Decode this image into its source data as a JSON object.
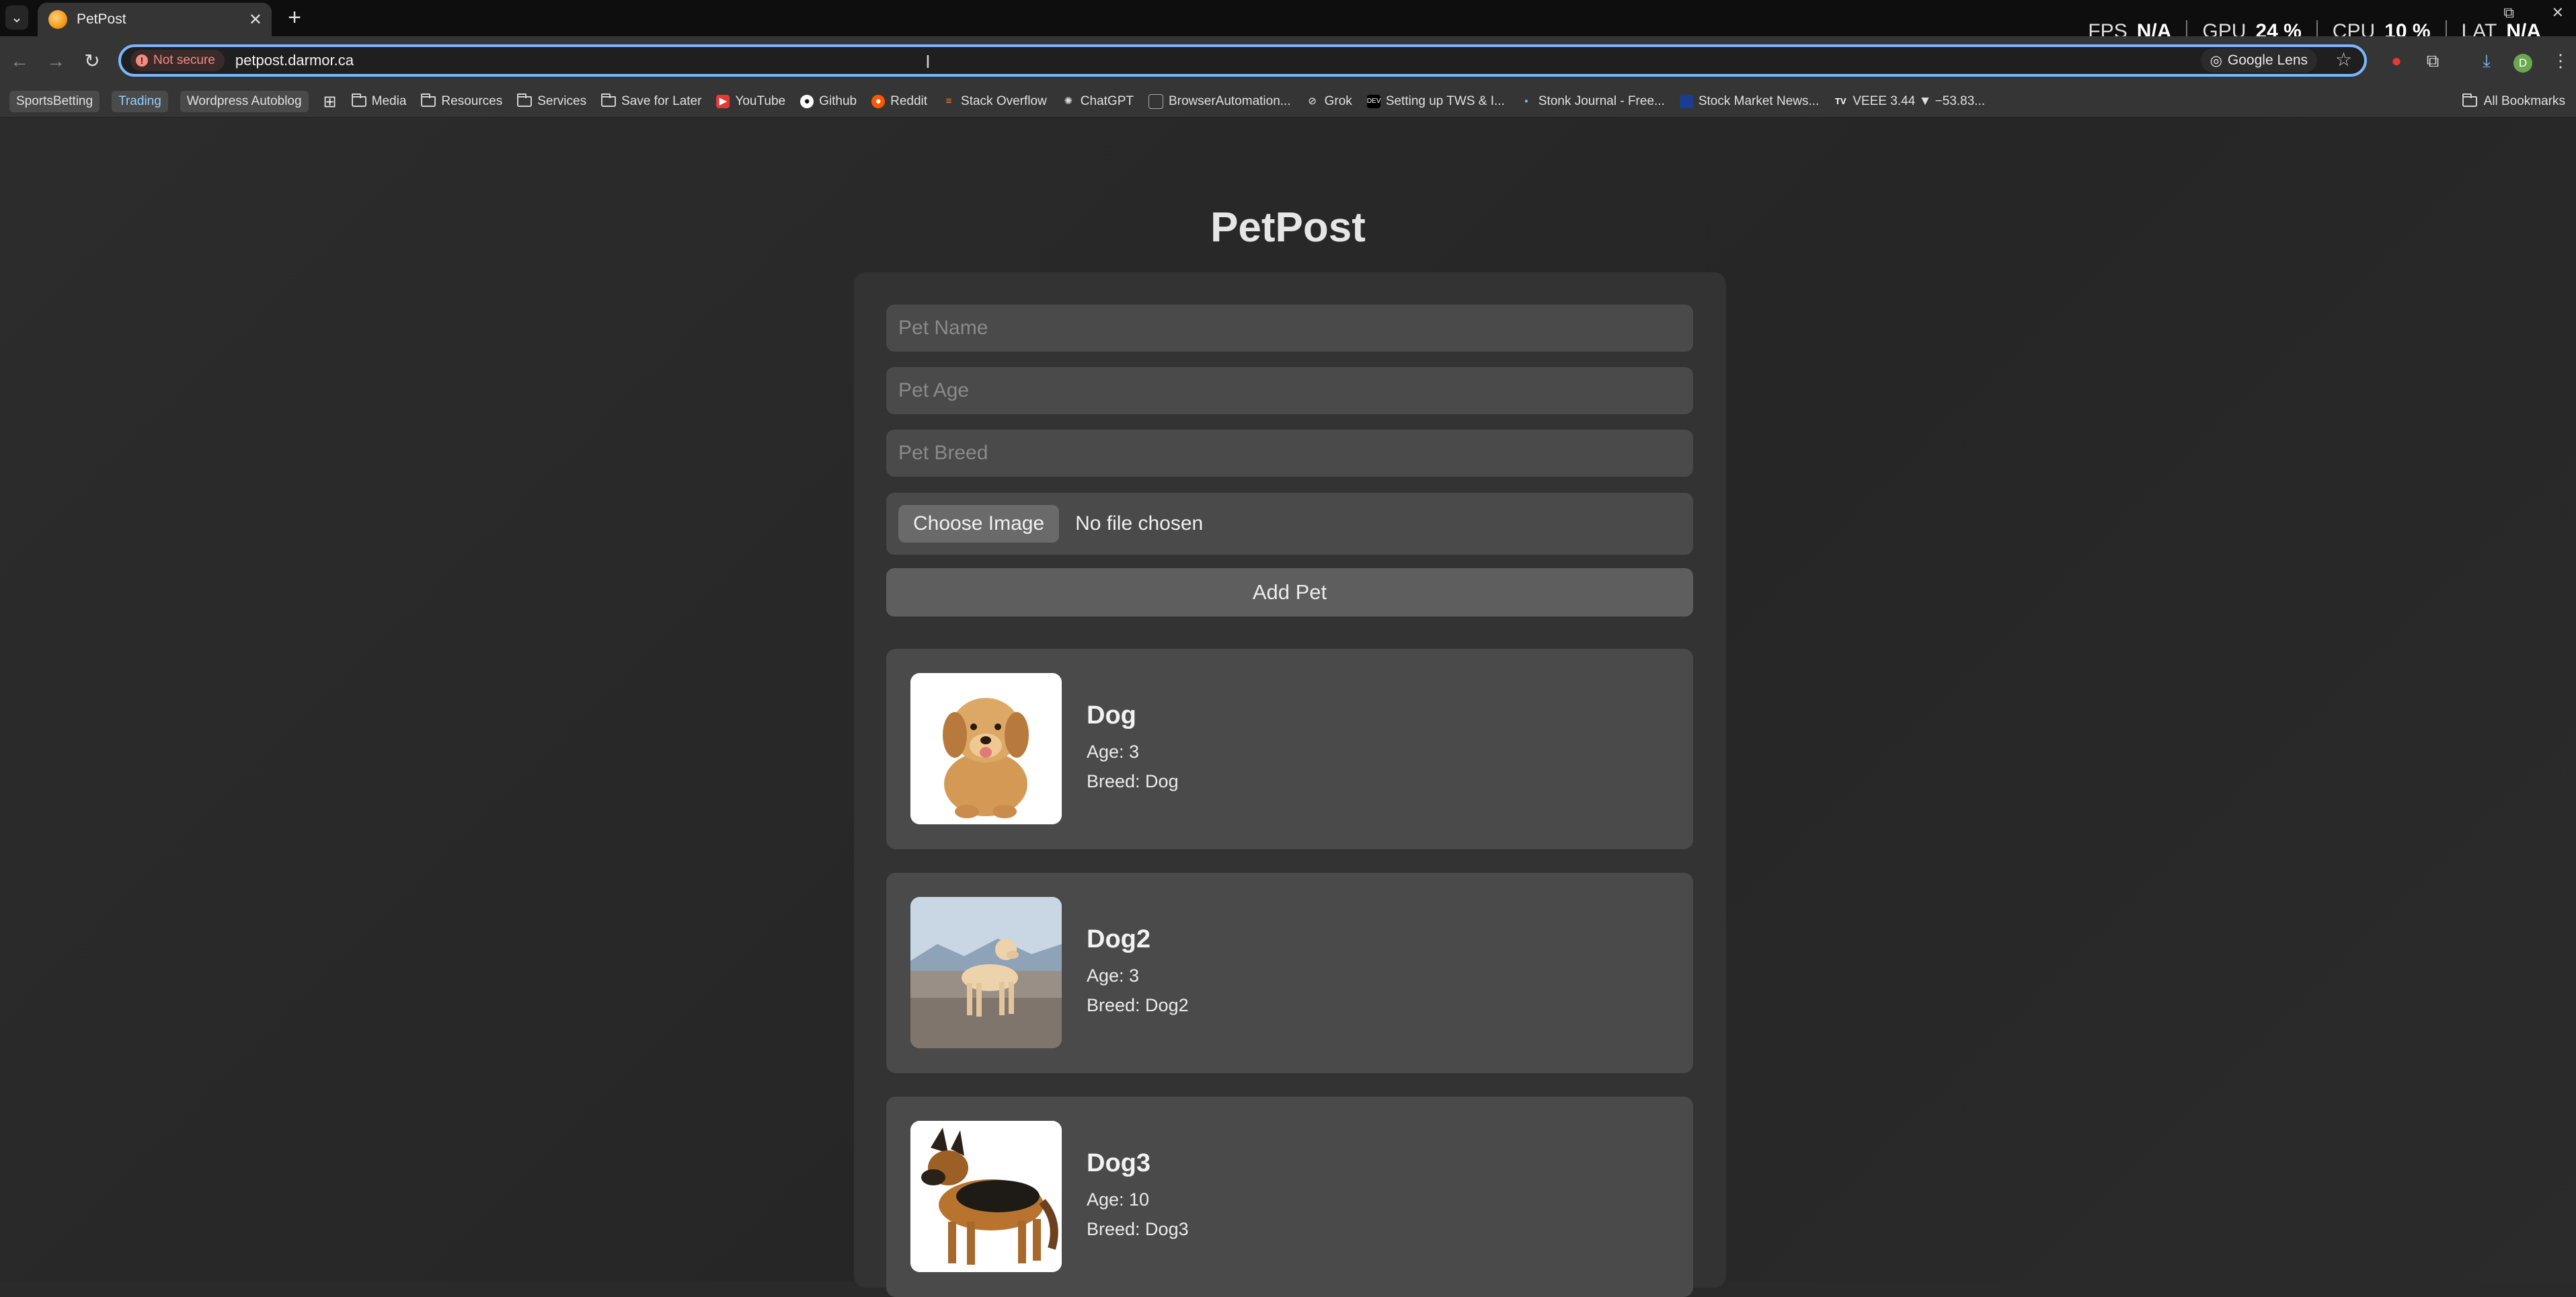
{
  "browser": {
    "tab_title": "PetPost",
    "security_chip": "Not secure",
    "url": "petpost.darmor.ca",
    "lens_label": "Google Lens",
    "perf": {
      "fps_label": "FPS",
      "fps_value": "N/A",
      "gpu_label": "GPU",
      "gpu_value": "24 %",
      "cpu_label": "CPU",
      "cpu_value": "10 %",
      "lat_label": "LAT",
      "lat_value": "N/A"
    },
    "profile_initial": "D",
    "bookmarks": [
      {
        "label": "SportsBetting",
        "kind": "pill"
      },
      {
        "label": "Trading",
        "kind": "pill"
      },
      {
        "label": "Wordpress Autoblog",
        "kind": "pill"
      },
      {
        "label": "Media",
        "kind": "folder"
      },
      {
        "label": "Resources",
        "kind": "folder"
      },
      {
        "label": "Services",
        "kind": "folder"
      },
      {
        "label": "Save for Later",
        "kind": "folder"
      },
      {
        "label": "YouTube",
        "kind": "site",
        "icon": "youtube-icon"
      },
      {
        "label": "Github",
        "kind": "site",
        "icon": "github-icon"
      },
      {
        "label": "Reddit",
        "kind": "site",
        "icon": "reddit-icon"
      },
      {
        "label": "Stack Overflow",
        "kind": "site",
        "icon": "stackoverflow-icon"
      },
      {
        "label": "ChatGPT",
        "kind": "site",
        "icon": "chatgpt-icon"
      },
      {
        "label": "BrowserAutomation...",
        "kind": "site",
        "icon": "page-icon"
      },
      {
        "label": "Grok",
        "kind": "site",
        "icon": "grok-icon"
      },
      {
        "label": "Setting up TWS & I...",
        "kind": "site",
        "icon": "dev-icon"
      },
      {
        "label": "Stonk Journal - Free...",
        "kind": "site",
        "icon": "page-icon"
      },
      {
        "label": "Stock Market News...",
        "kind": "site",
        "icon": "page-icon"
      },
      {
        "label": "VEEE 3.44 ▼ −53.83...",
        "kind": "site",
        "icon": "tv-icon"
      }
    ],
    "all_bookmarks": "All Bookmarks"
  },
  "app": {
    "title": "PetPost",
    "form": {
      "name_placeholder": "Pet Name",
      "age_placeholder": "Pet Age",
      "breed_placeholder": "Pet Breed",
      "choose_image": "Choose Image",
      "no_file": "No file chosen",
      "submit": "Add Pet"
    },
    "pets": [
      {
        "name": "Dog",
        "age": "Age: 3",
        "breed": "Breed: Dog",
        "photo": "golden-retriever-puppy-photo"
      },
      {
        "name": "Dog2",
        "age": "Age: 3",
        "breed": "Breed: Dog2",
        "photo": "labrador-on-beach-photo"
      },
      {
        "name": "Dog3",
        "age": "Age: 10",
        "breed": "Breed: Dog3",
        "photo": "german-shepherd-photo"
      }
    ]
  },
  "colors": {
    "background": "#2a2a2a",
    "panel": "#333333",
    "field": "#4a4a4a",
    "omnibox_focus": "#7ab7ff"
  }
}
